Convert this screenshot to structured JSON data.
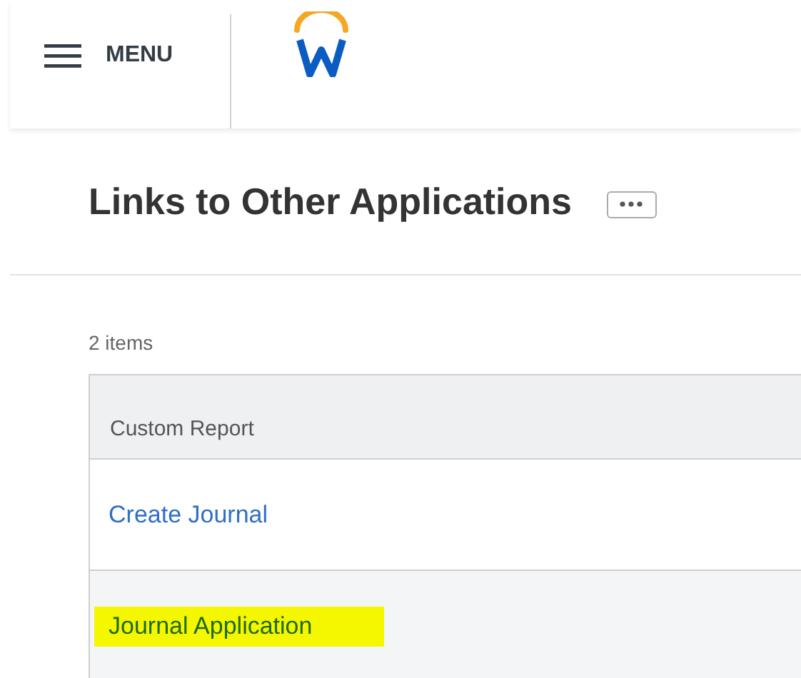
{
  "header": {
    "menu_label": "MENU"
  },
  "page": {
    "title": "Links to Other Applications",
    "item_count": "2 items"
  },
  "table": {
    "columns": [
      "Custom Report"
    ],
    "rows": [
      {
        "label": "Create Journal",
        "highlighted": false
      },
      {
        "label": "Journal Application",
        "highlighted": true
      }
    ]
  }
}
